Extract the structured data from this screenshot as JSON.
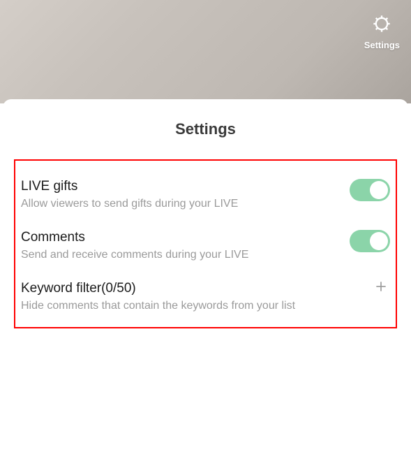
{
  "header": {
    "settings_label": "Settings"
  },
  "sheet": {
    "title": "Settings"
  },
  "settings": {
    "live_gifts": {
      "title": "LIVE gifts",
      "description": "Allow viewers to send gifts during your LIVE"
    },
    "comments": {
      "title": "Comments",
      "description": "Send and receive comments during your LIVE"
    },
    "keyword_filter": {
      "title": "Keyword filter(0/50)",
      "description": "Hide comments that contain the keywords from your list"
    }
  }
}
